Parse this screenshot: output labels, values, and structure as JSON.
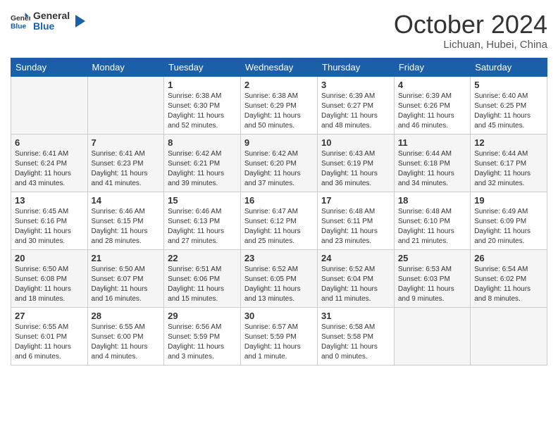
{
  "header": {
    "logo_line1": "General",
    "logo_line2": "Blue",
    "month": "October 2024",
    "location": "Lichuan, Hubei, China"
  },
  "weekdays": [
    "Sunday",
    "Monday",
    "Tuesday",
    "Wednesday",
    "Thursday",
    "Friday",
    "Saturday"
  ],
  "weeks": [
    [
      {
        "day": "",
        "info": ""
      },
      {
        "day": "",
        "info": ""
      },
      {
        "day": "1",
        "info": "Sunrise: 6:38 AM\nSunset: 6:30 PM\nDaylight: 11 hours and 52 minutes."
      },
      {
        "day": "2",
        "info": "Sunrise: 6:38 AM\nSunset: 6:29 PM\nDaylight: 11 hours and 50 minutes."
      },
      {
        "day": "3",
        "info": "Sunrise: 6:39 AM\nSunset: 6:27 PM\nDaylight: 11 hours and 48 minutes."
      },
      {
        "day": "4",
        "info": "Sunrise: 6:39 AM\nSunset: 6:26 PM\nDaylight: 11 hours and 46 minutes."
      },
      {
        "day": "5",
        "info": "Sunrise: 6:40 AM\nSunset: 6:25 PM\nDaylight: 11 hours and 45 minutes."
      }
    ],
    [
      {
        "day": "6",
        "info": "Sunrise: 6:41 AM\nSunset: 6:24 PM\nDaylight: 11 hours and 43 minutes."
      },
      {
        "day": "7",
        "info": "Sunrise: 6:41 AM\nSunset: 6:23 PM\nDaylight: 11 hours and 41 minutes."
      },
      {
        "day": "8",
        "info": "Sunrise: 6:42 AM\nSunset: 6:21 PM\nDaylight: 11 hours and 39 minutes."
      },
      {
        "day": "9",
        "info": "Sunrise: 6:42 AM\nSunset: 6:20 PM\nDaylight: 11 hours and 37 minutes."
      },
      {
        "day": "10",
        "info": "Sunrise: 6:43 AM\nSunset: 6:19 PM\nDaylight: 11 hours and 36 minutes."
      },
      {
        "day": "11",
        "info": "Sunrise: 6:44 AM\nSunset: 6:18 PM\nDaylight: 11 hours and 34 minutes."
      },
      {
        "day": "12",
        "info": "Sunrise: 6:44 AM\nSunset: 6:17 PM\nDaylight: 11 hours and 32 minutes."
      }
    ],
    [
      {
        "day": "13",
        "info": "Sunrise: 6:45 AM\nSunset: 6:16 PM\nDaylight: 11 hours and 30 minutes."
      },
      {
        "day": "14",
        "info": "Sunrise: 6:46 AM\nSunset: 6:15 PM\nDaylight: 11 hours and 28 minutes."
      },
      {
        "day": "15",
        "info": "Sunrise: 6:46 AM\nSunset: 6:13 PM\nDaylight: 11 hours and 27 minutes."
      },
      {
        "day": "16",
        "info": "Sunrise: 6:47 AM\nSunset: 6:12 PM\nDaylight: 11 hours and 25 minutes."
      },
      {
        "day": "17",
        "info": "Sunrise: 6:48 AM\nSunset: 6:11 PM\nDaylight: 11 hours and 23 minutes."
      },
      {
        "day": "18",
        "info": "Sunrise: 6:48 AM\nSunset: 6:10 PM\nDaylight: 11 hours and 21 minutes."
      },
      {
        "day": "19",
        "info": "Sunrise: 6:49 AM\nSunset: 6:09 PM\nDaylight: 11 hours and 20 minutes."
      }
    ],
    [
      {
        "day": "20",
        "info": "Sunrise: 6:50 AM\nSunset: 6:08 PM\nDaylight: 11 hours and 18 minutes."
      },
      {
        "day": "21",
        "info": "Sunrise: 6:50 AM\nSunset: 6:07 PM\nDaylight: 11 hours and 16 minutes."
      },
      {
        "day": "22",
        "info": "Sunrise: 6:51 AM\nSunset: 6:06 PM\nDaylight: 11 hours and 15 minutes."
      },
      {
        "day": "23",
        "info": "Sunrise: 6:52 AM\nSunset: 6:05 PM\nDaylight: 11 hours and 13 minutes."
      },
      {
        "day": "24",
        "info": "Sunrise: 6:52 AM\nSunset: 6:04 PM\nDaylight: 11 hours and 11 minutes."
      },
      {
        "day": "25",
        "info": "Sunrise: 6:53 AM\nSunset: 6:03 PM\nDaylight: 11 hours and 9 minutes."
      },
      {
        "day": "26",
        "info": "Sunrise: 6:54 AM\nSunset: 6:02 PM\nDaylight: 11 hours and 8 minutes."
      }
    ],
    [
      {
        "day": "27",
        "info": "Sunrise: 6:55 AM\nSunset: 6:01 PM\nDaylight: 11 hours and 6 minutes."
      },
      {
        "day": "28",
        "info": "Sunrise: 6:55 AM\nSunset: 6:00 PM\nDaylight: 11 hours and 4 minutes."
      },
      {
        "day": "29",
        "info": "Sunrise: 6:56 AM\nSunset: 5:59 PM\nDaylight: 11 hours and 3 minutes."
      },
      {
        "day": "30",
        "info": "Sunrise: 6:57 AM\nSunset: 5:59 PM\nDaylight: 11 hours and 1 minute."
      },
      {
        "day": "31",
        "info": "Sunrise: 6:58 AM\nSunset: 5:58 PM\nDaylight: 11 hours and 0 minutes."
      },
      {
        "day": "",
        "info": ""
      },
      {
        "day": "",
        "info": ""
      }
    ]
  ]
}
